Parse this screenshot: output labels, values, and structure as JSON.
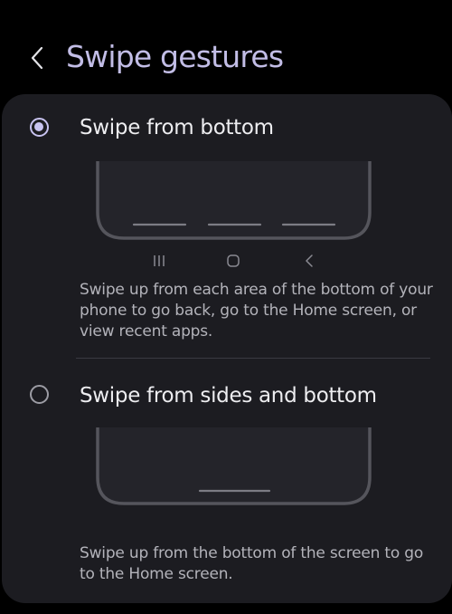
{
  "colors": {
    "background": "#000000",
    "card": "#1c1c21",
    "title": "#c2bde6",
    "accent": "#c8c3f0",
    "label": "#ededf0",
    "description": "#b3b3ba",
    "phone_outline": "#55555c",
    "nav_icons": "#8a8a92"
  },
  "header": {
    "back_icon": "chevron-left-icon",
    "title": "Swipe gestures"
  },
  "options": [
    {
      "label": "Swipe from bottom",
      "selected": true,
      "description": "Swipe up from each area of the bottom of your phone to go back, go to the Home screen, or view recent apps.",
      "nav_icons": [
        "recent-apps-icon",
        "home-icon",
        "back-icon"
      ]
    },
    {
      "label": "Swipe from sides and bottom",
      "selected": false,
      "description": "Swipe up from the bottom of the screen to go to the Home screen."
    }
  ]
}
